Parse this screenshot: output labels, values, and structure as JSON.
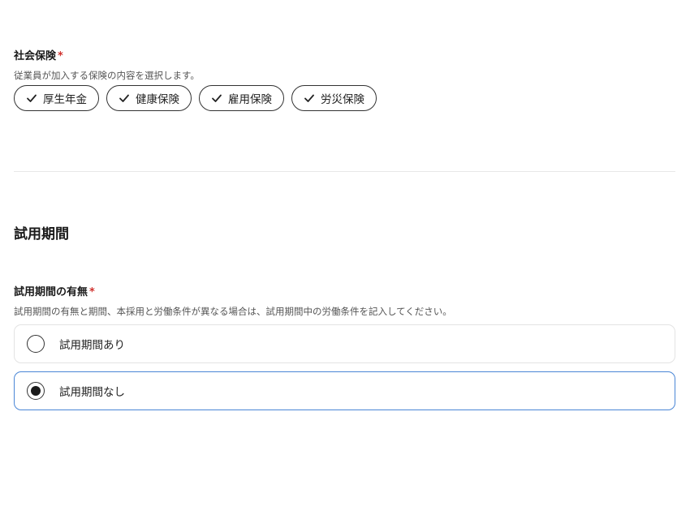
{
  "social_insurance": {
    "label": "社会保険",
    "required_mark": "*",
    "description": "従業員が加入する保険の内容を選択します。",
    "options": [
      {
        "label": "厚生年金",
        "checked": true
      },
      {
        "label": "健康保険",
        "checked": true
      },
      {
        "label": "雇用保険",
        "checked": true
      },
      {
        "label": "労災保険",
        "checked": true
      }
    ]
  },
  "probation_section": {
    "title": "試用期間"
  },
  "probation": {
    "label": "試用期間の有無",
    "required_mark": "*",
    "description": "試用期間の有無と期間、本採用と労働条件が異なる場合は、試用期間中の労働条件を記入してください。",
    "options": [
      {
        "label": "試用期間あり",
        "selected": false
      },
      {
        "label": "試用期間なし",
        "selected": true
      }
    ]
  },
  "colors": {
    "required": "#d0312d",
    "selected_border": "#4a86d6"
  }
}
